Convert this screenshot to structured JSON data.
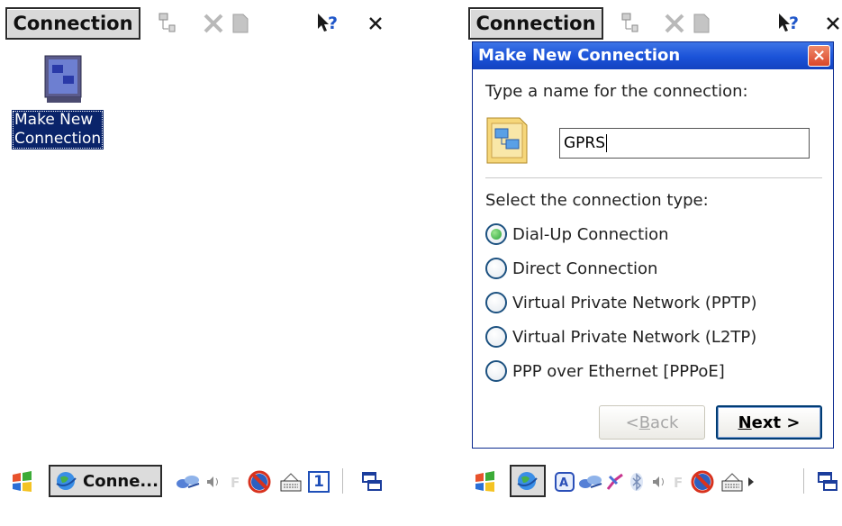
{
  "left": {
    "toolbar": {
      "connection_label": "Connection"
    },
    "desktop_icon": {
      "label": "Make New\nConnection"
    },
    "taskbar": {
      "task_label": "Conne...",
      "keypad_number": "1"
    }
  },
  "right": {
    "toolbar": {
      "connection_label": "Connection"
    },
    "dialog": {
      "title": "Make New Connection",
      "close_label": "×",
      "name_prompt": "Type a name for the connection:",
      "name_value": "GPRS",
      "type_prompt": "Select the connection type:",
      "options": [
        {
          "label": "Dial-Up Connection",
          "selected": true
        },
        {
          "label": "Direct Connection",
          "selected": false
        },
        {
          "label": "Virtual Private Network (PPTP)",
          "selected": false
        },
        {
          "label": "Virtual Private Network (L2TP)",
          "selected": false
        },
        {
          "label": "PPP over Ethernet [PPPoE]",
          "selected": false
        }
      ],
      "back_label": "< Back",
      "next_label": "Next >"
    }
  },
  "colors": {
    "title_bar": "#1a52d8",
    "selection": "#0a246a",
    "radio_selected": "#2aa43a"
  }
}
